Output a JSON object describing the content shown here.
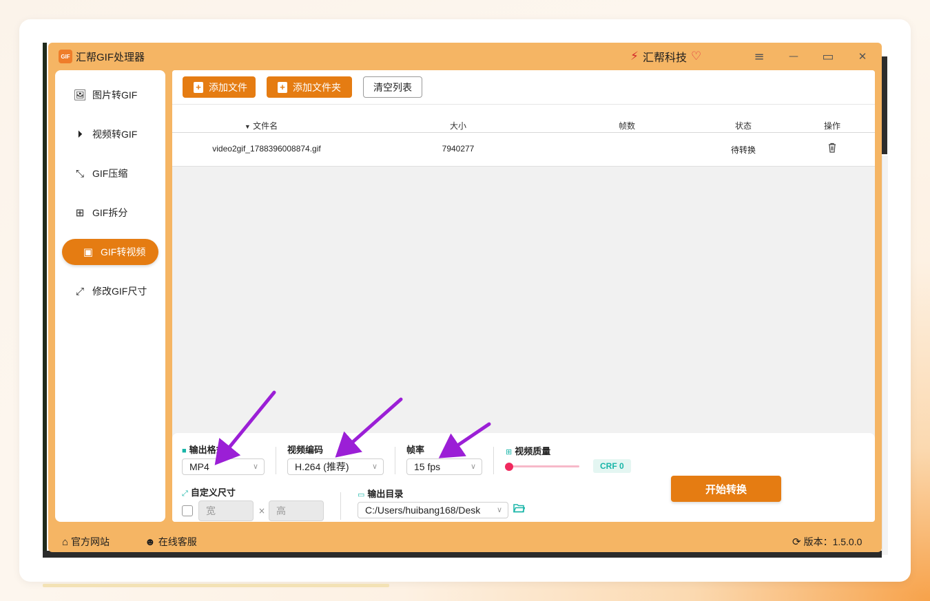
{
  "app": {
    "title": "汇帮GIF处理器",
    "logo_text": "GIF",
    "brand_name": "汇帮科技"
  },
  "window_controls": {
    "menu_icon": "≡",
    "minimize_icon": "—",
    "maximize_icon": "▭",
    "close_icon": "✕"
  },
  "sidebar": {
    "items": [
      {
        "label": "图片转GIF",
        "icon": "image-icon",
        "active": false
      },
      {
        "label": "视频转GIF",
        "icon": "play-circle-icon",
        "active": false
      },
      {
        "label": "GIF压缩",
        "icon": "compress-arrows-icon",
        "active": false
      },
      {
        "label": "GIF拆分",
        "icon": "split-icon",
        "active": false
      },
      {
        "label": "GIF转视频",
        "icon": "video-camera-icon",
        "active": true
      },
      {
        "label": "修改GIF尺寸",
        "icon": "resize-icon",
        "active": false
      }
    ]
  },
  "toolbar": {
    "add_file": "添加文件",
    "add_folder": "添加文件夹",
    "clear_list": "清空列表"
  },
  "table": {
    "columns": [
      "文件名",
      "大小",
      "帧数",
      "状态",
      "操作"
    ],
    "sort_indicator": "▼",
    "rows": [
      {
        "filename": "video2gif_1788396008874.gif",
        "size": "7940277",
        "frames": "",
        "status": "待转换",
        "action_icon": "trash-icon"
      }
    ]
  },
  "settings": {
    "output_format_label": "输出格式",
    "output_format_value": "MP4",
    "video_codec_label": "视频编码",
    "video_codec_value": "H.264 (推荐)",
    "frame_rate_label": "帧率",
    "frame_rate_value": "15 fps",
    "video_quality_label": "视频质量",
    "crf_badge": "CRF 0",
    "crf_slider_fraction": 0.0,
    "custom_size_label": "自定义尺寸",
    "custom_size_checked": false,
    "width_placeholder": "宽",
    "height_placeholder": "高",
    "times_symbol": "×",
    "output_dir_label": "输出目录",
    "output_dir_value": "C:/Users/huibang168/Desk",
    "start_button": "开始转换"
  },
  "footer": {
    "website": "官方网站",
    "support": "在线客服",
    "version": "版本：1.5.0.0"
  },
  "colors": {
    "accent": "#e57c12",
    "frame": "#f5b564",
    "teal": "#18b5a8",
    "annotation_arrow": "#9b1fd6"
  }
}
